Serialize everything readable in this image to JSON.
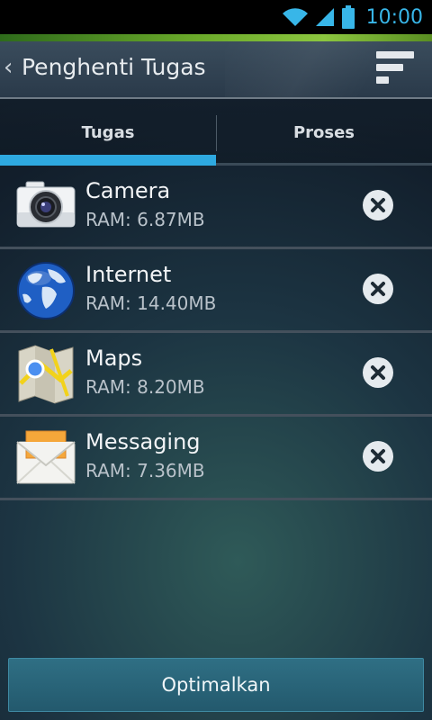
{
  "status_bar": {
    "time": "10:00",
    "icons": [
      "wifi-icon",
      "signal-icon",
      "battery-icon"
    ]
  },
  "action_bar": {
    "title": "Penghenti Tugas",
    "menu_icon": "sort-menu-icon"
  },
  "tabs": [
    {
      "label": "Tugas",
      "selected": true
    },
    {
      "label": "Proses",
      "selected": false
    }
  ],
  "tasks": [
    {
      "name": "Camera",
      "ram": "RAM: 6.87MB",
      "icon": "camera-app-icon"
    },
    {
      "name": "Internet",
      "ram": "RAM: 14.40MB",
      "icon": "globe-app-icon"
    },
    {
      "name": "Maps",
      "ram": "RAM: 8.20MB",
      "icon": "maps-app-icon"
    },
    {
      "name": "Messaging",
      "ram": "RAM: 7.36MB",
      "icon": "messaging-app-icon"
    }
  ],
  "actions": {
    "optimize_label": "Optimalkan"
  },
  "colors": {
    "accent": "#2ea9e0",
    "status_text": "#38b6e8",
    "strip": "#8cc63f"
  }
}
